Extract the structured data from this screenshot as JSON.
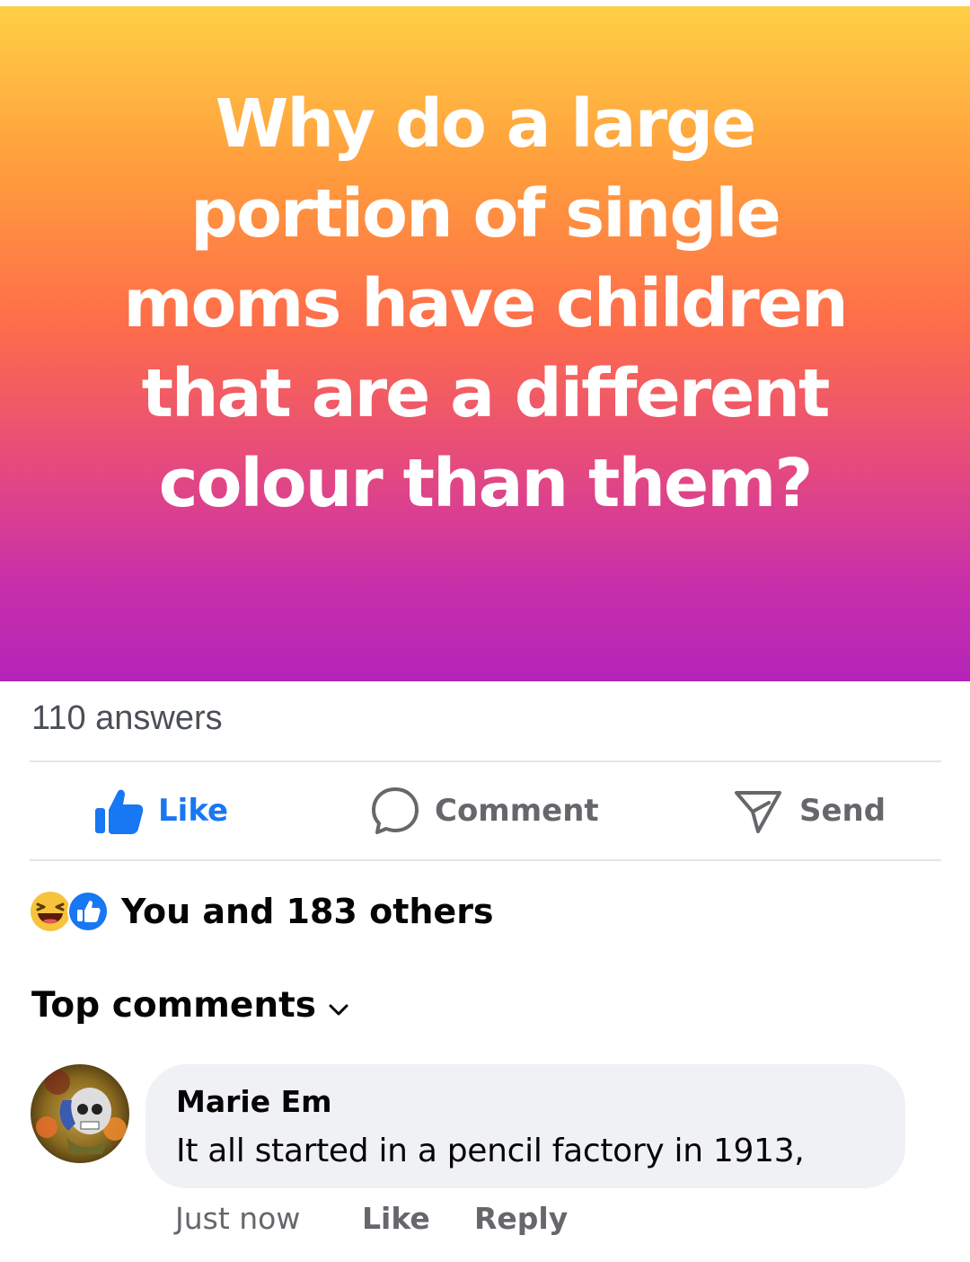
{
  "post": {
    "question": "Why do a large portion of single moms have children that are a different colour than them?",
    "answers_count": "110 answers"
  },
  "actions": {
    "like_label": "Like",
    "comment_label": "Comment",
    "send_label": "Send"
  },
  "reactions": {
    "icons": [
      "laugh-emoji-icon",
      "like-reaction-icon"
    ],
    "summary": "You and 183 others"
  },
  "comments_header": "Top comments",
  "comment": {
    "author": "Marie Em",
    "text": "It all started in a pencil factory in 1913,",
    "time": "Just now",
    "like_label": "Like",
    "reply_label": "Reply"
  },
  "colors": {
    "like_blue": "#1877f2",
    "action_gray": "#65676b",
    "bubble_bg": "#f0f1f4"
  }
}
